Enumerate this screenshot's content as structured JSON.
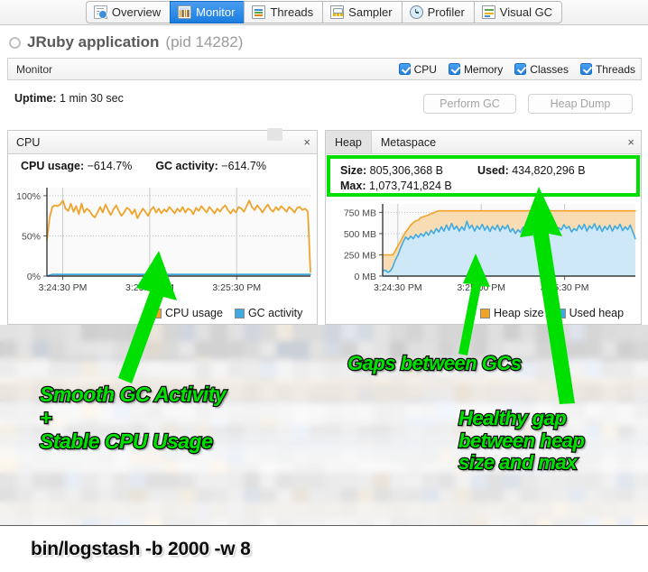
{
  "tabs": [
    {
      "label": "Overview",
      "icon": "overview-document-icon",
      "active": false
    },
    {
      "label": "Monitor",
      "icon": "monitor-chart-icon",
      "active": true
    },
    {
      "label": "Threads",
      "icon": "threads-list-icon",
      "active": false
    },
    {
      "label": "Sampler",
      "icon": "sampler-icon",
      "active": false
    },
    {
      "label": "Profiler",
      "icon": "profiler-clock-icon",
      "active": false
    },
    {
      "label": "Visual GC",
      "icon": "visual-gc-icon",
      "active": false
    }
  ],
  "app": {
    "name": "JRuby application",
    "pid": "(pid 14282)"
  },
  "monitor_bar": {
    "title": "Monitor",
    "checkboxes": [
      {
        "label": "CPU",
        "checked": true
      },
      {
        "label": "Memory",
        "checked": true
      },
      {
        "label": "Classes",
        "checked": true
      },
      {
        "label": "Threads",
        "checked": true
      }
    ]
  },
  "uptime": {
    "label": "Uptime:",
    "value": "1 min 30 sec"
  },
  "buttons": {
    "perform_gc": "Perform GC",
    "heap_dump": "Heap Dump"
  },
  "cpu_panel": {
    "title": "CPU",
    "close": "×",
    "metrics": [
      {
        "label": "CPU usage:",
        "value": "−614.7%"
      },
      {
        "label": "GC activity:",
        "value": "−614.7%"
      }
    ],
    "legend": [
      {
        "label": "CPU usage",
        "color": "#f0a32a"
      },
      {
        "label": "GC activity",
        "color": "#3fa9e0"
      }
    ]
  },
  "heap_panel": {
    "tabs": [
      {
        "label": "Heap",
        "active": true
      },
      {
        "label": "Metaspace",
        "active": false
      }
    ],
    "close": "×",
    "metrics": [
      {
        "label": "Size:",
        "value": "805,306,368 B"
      },
      {
        "label": "Used:",
        "value": "434,820,296 B"
      },
      {
        "label": "Max:",
        "value": "1,073,741,824 B"
      }
    ],
    "legend": [
      {
        "label": "Heap size",
        "color": "#f0a32a"
      },
      {
        "label": "Used heap",
        "color": "#3fa9e0"
      }
    ],
    "highlight_color": "#00e000"
  },
  "annotations": [
    {
      "name": "smooth-gc-cpu",
      "text": "Smooth GC Activity\n+\nStable CPU Usage"
    },
    {
      "name": "gaps-between-gcs",
      "text": "Gaps between GCs"
    },
    {
      "name": "healthy-gap",
      "text": "Healthy gap\nbetween heap\nsize and max"
    }
  ],
  "bottom_command": "bin/logstash -b 2000 -w 8",
  "chart_data": [
    {
      "type": "line",
      "name": "cpu-chart",
      "title": "CPU",
      "xlabel": "",
      "ylabel": "",
      "ylim": [
        0,
        110
      ],
      "yticks": [
        0,
        50,
        100
      ],
      "ytick_labels": [
        "0%",
        "50%",
        "100%"
      ],
      "xtick_labels": [
        "3:24:30 PM",
        "3:25:00 PM",
        "3:25:30 PM"
      ],
      "grid": true,
      "legend_position": "bottom-right",
      "series": [
        {
          "name": "CPU usage",
          "color": "#f0a32a",
          "values": [
            45,
            72,
            86,
            88,
            87,
            89,
            94,
            84,
            81,
            90,
            80,
            87,
            77,
            90,
            79,
            84,
            81,
            76,
            73,
            79,
            86,
            79,
            89,
            82,
            76,
            83,
            88,
            81,
            75,
            79,
            85,
            83,
            77,
            83,
            72,
            78,
            84,
            80,
            75,
            82,
            86,
            79,
            84,
            78,
            83,
            80,
            86,
            82,
            78,
            84,
            80,
            86,
            79,
            84,
            82,
            77,
            85,
            81,
            87,
            83,
            79,
            86,
            82,
            78,
            84,
            80,
            85,
            88,
            82,
            78,
            83,
            79,
            86,
            84,
            80,
            87,
            94,
            86,
            82,
            88,
            84,
            79,
            85,
            89,
            83,
            80,
            86,
            82,
            87,
            84,
            80,
            86,
            83,
            79,
            85,
            86,
            82,
            84,
            80,
            5
          ]
        },
        {
          "name": "GC activity",
          "color": "#3fa9e0",
          "values": [
            0,
            1,
            2,
            2,
            2,
            2,
            2,
            2,
            2,
            2,
            2,
            2,
            2,
            2,
            2,
            2,
            2,
            2,
            2,
            2,
            2,
            2,
            2,
            2,
            2,
            2,
            2,
            2,
            2,
            2,
            2,
            2,
            2,
            2,
            2,
            2,
            2,
            2,
            2,
            2,
            2,
            2,
            2,
            2,
            2,
            2,
            2,
            2,
            2,
            2,
            2,
            2,
            2,
            2,
            2,
            2,
            2,
            2,
            2,
            2,
            2,
            2,
            2,
            2,
            2,
            2,
            2,
            2,
            2,
            2,
            2,
            2,
            2,
            2,
            2,
            2,
            2,
            2,
            2,
            2,
            2,
            2,
            2,
            2,
            2,
            2,
            2,
            2,
            2,
            2,
            2,
            2,
            2,
            2,
            2,
            2,
            2,
            2,
            2,
            2
          ]
        }
      ]
    },
    {
      "type": "area",
      "name": "heap-chart",
      "title": "Heap",
      "xlabel": "",
      "ylabel": "",
      "ylim": [
        0,
        850
      ],
      "yticks": [
        0,
        250,
        500,
        750
      ],
      "ytick_labels": [
        "0 MB",
        "250 MB",
        "500 MB",
        "750 MB"
      ],
      "xtick_labels": [
        "3:24:30 PM",
        "3:25:00 PM",
        "3:25:30 PM"
      ],
      "grid": true,
      "legend_position": "bottom-right",
      "series": [
        {
          "name": "Heap size",
          "color": "#f0a32a",
          "fill": "#f7dcb4",
          "values": [
            250,
            250,
            250,
            250,
            250,
            300,
            360,
            410,
            470,
            520,
            560,
            600,
            630,
            650,
            660,
            690,
            700,
            710,
            720,
            735,
            745,
            760,
            768,
            768,
            768,
            768,
            768,
            768,
            768,
            768,
            768,
            768,
            768,
            768,
            768,
            768,
            768,
            768,
            768,
            768,
            768,
            768,
            768,
            768,
            768,
            768,
            768,
            768,
            768,
            768,
            768,
            768,
            768,
            768,
            768,
            768,
            768,
            768,
            768,
            768,
            768,
            768,
            768,
            768,
            768,
            768,
            768,
            768,
            768,
            768,
            768,
            768,
            768,
            768,
            768,
            768,
            768,
            768,
            768,
            768,
            768,
            768,
            768,
            768,
            768,
            768,
            768,
            768,
            768,
            768,
            768,
            768,
            768,
            768,
            768,
            768,
            768,
            768,
            768,
            768
          ]
        },
        {
          "name": "Used heap",
          "color": "#3fa9e0",
          "fill": "#cfe8f7",
          "values": [
            60,
            70,
            45,
            60,
            110,
            190,
            250,
            330,
            400,
            460,
            430,
            470,
            440,
            490,
            455,
            500,
            470,
            520,
            480,
            540,
            500,
            560,
            520,
            580,
            530,
            600,
            540,
            620,
            550,
            590,
            530,
            580,
            540,
            645,
            560,
            600,
            530,
            590,
            550,
            610,
            540,
            590,
            525,
            585,
            545,
            600,
            530,
            590,
            555,
            600,
            520,
            560,
            500,
            545,
            515,
            575,
            540,
            595,
            525,
            585,
            545,
            620,
            560,
            600,
            530,
            645,
            540,
            600,
            520,
            570,
            545,
            605,
            560,
            585,
            520,
            560,
            535,
            600,
            550,
            610,
            530,
            590,
            560,
            615,
            540,
            595,
            525,
            585,
            545,
            600,
            530,
            590,
            555,
            610,
            535,
            580,
            545,
            600,
            520,
            440
          ]
        }
      ]
    }
  ]
}
